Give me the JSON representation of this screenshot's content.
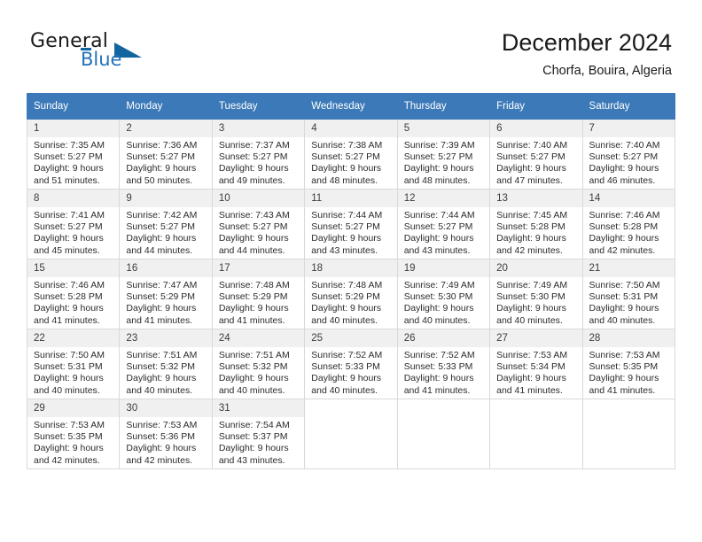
{
  "brand": {
    "name_top": "General",
    "name_bottom": "Blue",
    "accent_color": "#12659f",
    "blue_text_color": "#2272b8"
  },
  "header": {
    "title": "December 2024",
    "subtitle": "Chorfa, Bouira, Algeria"
  },
  "calendar": {
    "header_bg": "#3b79b8",
    "weekdays": [
      "Sunday",
      "Monday",
      "Tuesday",
      "Wednesday",
      "Thursday",
      "Friday",
      "Saturday"
    ],
    "weeks": [
      [
        {
          "day": "1",
          "sunrise": "Sunrise: 7:35 AM",
          "sunset": "Sunset: 5:27 PM",
          "daylight1": "Daylight: 9 hours",
          "daylight2": "and 51 minutes."
        },
        {
          "day": "2",
          "sunrise": "Sunrise: 7:36 AM",
          "sunset": "Sunset: 5:27 PM",
          "daylight1": "Daylight: 9 hours",
          "daylight2": "and 50 minutes."
        },
        {
          "day": "3",
          "sunrise": "Sunrise: 7:37 AM",
          "sunset": "Sunset: 5:27 PM",
          "daylight1": "Daylight: 9 hours",
          "daylight2": "and 49 minutes."
        },
        {
          "day": "4",
          "sunrise": "Sunrise: 7:38 AM",
          "sunset": "Sunset: 5:27 PM",
          "daylight1": "Daylight: 9 hours",
          "daylight2": "and 48 minutes."
        },
        {
          "day": "5",
          "sunrise": "Sunrise: 7:39 AM",
          "sunset": "Sunset: 5:27 PM",
          "daylight1": "Daylight: 9 hours",
          "daylight2": "and 48 minutes."
        },
        {
          "day": "6",
          "sunrise": "Sunrise: 7:40 AM",
          "sunset": "Sunset: 5:27 PM",
          "daylight1": "Daylight: 9 hours",
          "daylight2": "and 47 minutes."
        },
        {
          "day": "7",
          "sunrise": "Sunrise: 7:40 AM",
          "sunset": "Sunset: 5:27 PM",
          "daylight1": "Daylight: 9 hours",
          "daylight2": "and 46 minutes."
        }
      ],
      [
        {
          "day": "8",
          "sunrise": "Sunrise: 7:41 AM",
          "sunset": "Sunset: 5:27 PM",
          "daylight1": "Daylight: 9 hours",
          "daylight2": "and 45 minutes."
        },
        {
          "day": "9",
          "sunrise": "Sunrise: 7:42 AM",
          "sunset": "Sunset: 5:27 PM",
          "daylight1": "Daylight: 9 hours",
          "daylight2": "and 44 minutes."
        },
        {
          "day": "10",
          "sunrise": "Sunrise: 7:43 AM",
          "sunset": "Sunset: 5:27 PM",
          "daylight1": "Daylight: 9 hours",
          "daylight2": "and 44 minutes."
        },
        {
          "day": "11",
          "sunrise": "Sunrise: 7:44 AM",
          "sunset": "Sunset: 5:27 PM",
          "daylight1": "Daylight: 9 hours",
          "daylight2": "and 43 minutes."
        },
        {
          "day": "12",
          "sunrise": "Sunrise: 7:44 AM",
          "sunset": "Sunset: 5:27 PM",
          "daylight1": "Daylight: 9 hours",
          "daylight2": "and 43 minutes."
        },
        {
          "day": "13",
          "sunrise": "Sunrise: 7:45 AM",
          "sunset": "Sunset: 5:28 PM",
          "daylight1": "Daylight: 9 hours",
          "daylight2": "and 42 minutes."
        },
        {
          "day": "14",
          "sunrise": "Sunrise: 7:46 AM",
          "sunset": "Sunset: 5:28 PM",
          "daylight1": "Daylight: 9 hours",
          "daylight2": "and 42 minutes."
        }
      ],
      [
        {
          "day": "15",
          "sunrise": "Sunrise: 7:46 AM",
          "sunset": "Sunset: 5:28 PM",
          "daylight1": "Daylight: 9 hours",
          "daylight2": "and 41 minutes."
        },
        {
          "day": "16",
          "sunrise": "Sunrise: 7:47 AM",
          "sunset": "Sunset: 5:29 PM",
          "daylight1": "Daylight: 9 hours",
          "daylight2": "and 41 minutes."
        },
        {
          "day": "17",
          "sunrise": "Sunrise: 7:48 AM",
          "sunset": "Sunset: 5:29 PM",
          "daylight1": "Daylight: 9 hours",
          "daylight2": "and 41 minutes."
        },
        {
          "day": "18",
          "sunrise": "Sunrise: 7:48 AM",
          "sunset": "Sunset: 5:29 PM",
          "daylight1": "Daylight: 9 hours",
          "daylight2": "and 40 minutes."
        },
        {
          "day": "19",
          "sunrise": "Sunrise: 7:49 AM",
          "sunset": "Sunset: 5:30 PM",
          "daylight1": "Daylight: 9 hours",
          "daylight2": "and 40 minutes."
        },
        {
          "day": "20",
          "sunrise": "Sunrise: 7:49 AM",
          "sunset": "Sunset: 5:30 PM",
          "daylight1": "Daylight: 9 hours",
          "daylight2": "and 40 minutes."
        },
        {
          "day": "21",
          "sunrise": "Sunrise: 7:50 AM",
          "sunset": "Sunset: 5:31 PM",
          "daylight1": "Daylight: 9 hours",
          "daylight2": "and 40 minutes."
        }
      ],
      [
        {
          "day": "22",
          "sunrise": "Sunrise: 7:50 AM",
          "sunset": "Sunset: 5:31 PM",
          "daylight1": "Daylight: 9 hours",
          "daylight2": "and 40 minutes."
        },
        {
          "day": "23",
          "sunrise": "Sunrise: 7:51 AM",
          "sunset": "Sunset: 5:32 PM",
          "daylight1": "Daylight: 9 hours",
          "daylight2": "and 40 minutes."
        },
        {
          "day": "24",
          "sunrise": "Sunrise: 7:51 AM",
          "sunset": "Sunset: 5:32 PM",
          "daylight1": "Daylight: 9 hours",
          "daylight2": "and 40 minutes."
        },
        {
          "day": "25",
          "sunrise": "Sunrise: 7:52 AM",
          "sunset": "Sunset: 5:33 PM",
          "daylight1": "Daylight: 9 hours",
          "daylight2": "and 40 minutes."
        },
        {
          "day": "26",
          "sunrise": "Sunrise: 7:52 AM",
          "sunset": "Sunset: 5:33 PM",
          "daylight1": "Daylight: 9 hours",
          "daylight2": "and 41 minutes."
        },
        {
          "day": "27",
          "sunrise": "Sunrise: 7:53 AM",
          "sunset": "Sunset: 5:34 PM",
          "daylight1": "Daylight: 9 hours",
          "daylight2": "and 41 minutes."
        },
        {
          "day": "28",
          "sunrise": "Sunrise: 7:53 AM",
          "sunset": "Sunset: 5:35 PM",
          "daylight1": "Daylight: 9 hours",
          "daylight2": "and 41 minutes."
        }
      ],
      [
        {
          "day": "29",
          "sunrise": "Sunrise: 7:53 AM",
          "sunset": "Sunset: 5:35 PM",
          "daylight1": "Daylight: 9 hours",
          "daylight2": "and 42 minutes."
        },
        {
          "day": "30",
          "sunrise": "Sunrise: 7:53 AM",
          "sunset": "Sunset: 5:36 PM",
          "daylight1": "Daylight: 9 hours",
          "daylight2": "and 42 minutes."
        },
        {
          "day": "31",
          "sunrise": "Sunrise: 7:54 AM",
          "sunset": "Sunset: 5:37 PM",
          "daylight1": "Daylight: 9 hours",
          "daylight2": "and 43 minutes."
        },
        {
          "day": "",
          "sunrise": "",
          "sunset": "",
          "daylight1": "",
          "daylight2": ""
        },
        {
          "day": "",
          "sunrise": "",
          "sunset": "",
          "daylight1": "",
          "daylight2": ""
        },
        {
          "day": "",
          "sunrise": "",
          "sunset": "",
          "daylight1": "",
          "daylight2": ""
        },
        {
          "day": "",
          "sunrise": "",
          "sunset": "",
          "daylight1": "",
          "daylight2": ""
        }
      ]
    ]
  }
}
